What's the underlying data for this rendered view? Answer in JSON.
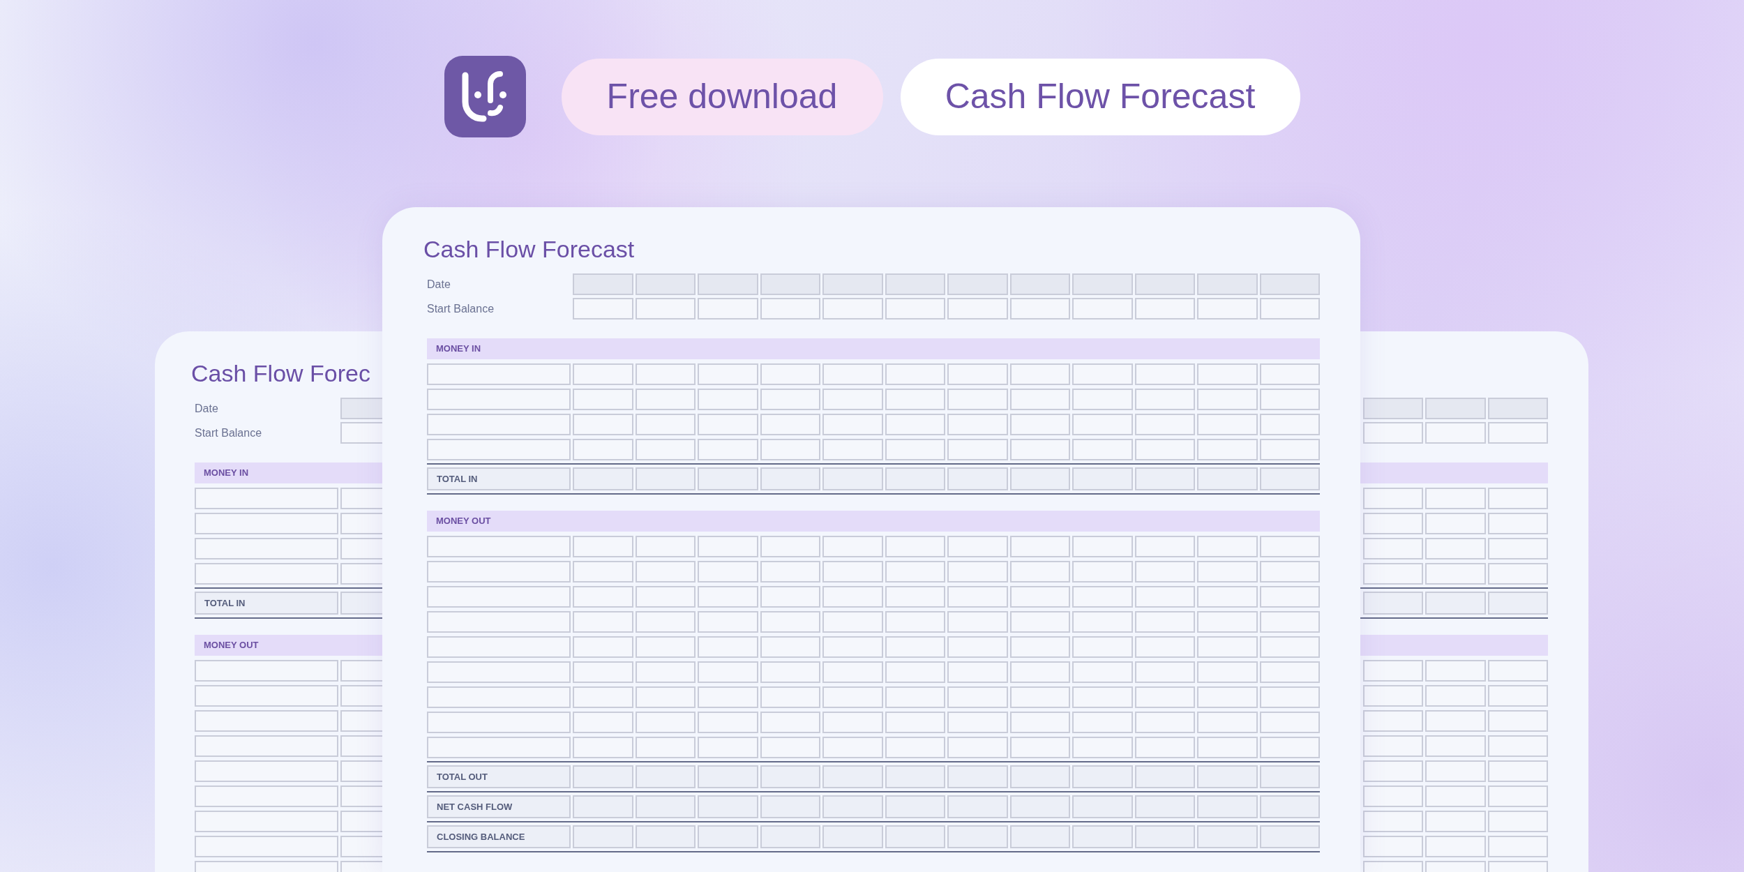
{
  "header": {
    "tags": [
      {
        "label": "Free download",
        "kind": "download"
      },
      {
        "label": "Cash Flow Forecast",
        "kind": "title"
      }
    ]
  },
  "sheets": [
    {
      "kind": "left",
      "title": "Cash Flow Forec",
      "rows": [
        {
          "kind": "date",
          "label": "Date"
        },
        {
          "kind": "balance",
          "label": "Start Balance"
        },
        {
          "kind": "section",
          "label": "MONEY IN"
        },
        {
          "kind": "entry"
        },
        {
          "kind": "entry"
        },
        {
          "kind": "entry"
        },
        {
          "kind": "entry"
        },
        {
          "kind": "total",
          "label": "TOTAL IN"
        },
        {
          "kind": "section",
          "label": "MONEY OUT"
        },
        {
          "kind": "entry"
        },
        {
          "kind": "entry"
        },
        {
          "kind": "entry"
        },
        {
          "kind": "entry"
        },
        {
          "kind": "entry"
        },
        {
          "kind": "entry"
        },
        {
          "kind": "entry"
        },
        {
          "kind": "entry"
        },
        {
          "kind": "entry"
        }
      ]
    },
    {
      "kind": "right",
      "rows": [
        {
          "kind": "date"
        },
        {
          "kind": "balance"
        },
        {
          "kind": "section"
        },
        {
          "kind": "entry"
        },
        {
          "kind": "entry"
        },
        {
          "kind": "entry"
        },
        {
          "kind": "entry"
        },
        {
          "kind": "total"
        },
        {
          "kind": "section"
        },
        {
          "kind": "entry"
        },
        {
          "kind": "entry"
        },
        {
          "kind": "entry"
        },
        {
          "kind": "entry"
        },
        {
          "kind": "entry"
        },
        {
          "kind": "entry"
        },
        {
          "kind": "entry"
        },
        {
          "kind": "entry"
        },
        {
          "kind": "entry"
        }
      ]
    },
    {
      "kind": "center",
      "title": "Cash Flow Forecast",
      "rows": [
        {
          "kind": "date",
          "label": "Date"
        },
        {
          "kind": "balance",
          "label": "Start Balance"
        },
        {
          "kind": "section",
          "label": "MONEY IN"
        },
        {
          "kind": "entry"
        },
        {
          "kind": "entry"
        },
        {
          "kind": "entry"
        },
        {
          "kind": "entry"
        },
        {
          "kind": "total",
          "label": "TOTAL IN"
        },
        {
          "kind": "section",
          "label": "MONEY OUT"
        },
        {
          "kind": "entry"
        },
        {
          "kind": "entry"
        },
        {
          "kind": "entry"
        },
        {
          "kind": "entry"
        },
        {
          "kind": "entry"
        },
        {
          "kind": "entry"
        },
        {
          "kind": "entry"
        },
        {
          "kind": "entry"
        },
        {
          "kind": "entry"
        },
        {
          "kind": "total",
          "label": "TOTAL OUT"
        },
        {
          "kind": "total",
          "label": "NET CASH FLOW"
        },
        {
          "kind": "total",
          "label": "CLOSING BALANCE"
        }
      ]
    }
  ]
}
